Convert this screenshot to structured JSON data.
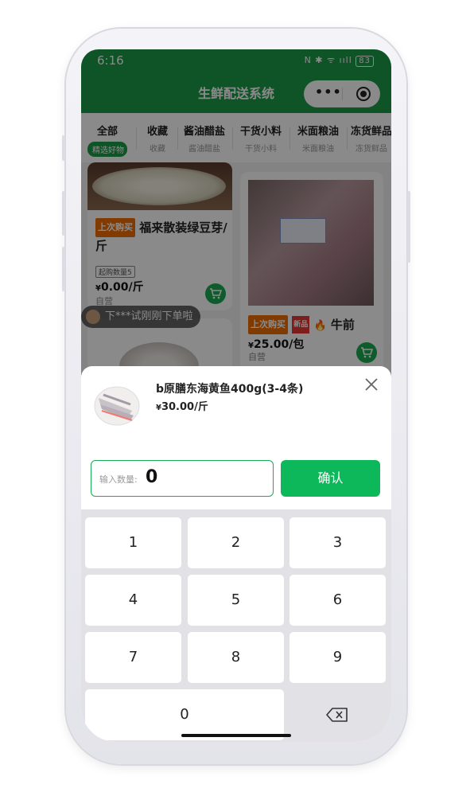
{
  "status_bar": {
    "time": "6:16",
    "icons": "N ✱ ᯤ ııll",
    "battery": "83"
  },
  "header": {
    "title": "生鲜配送系统"
  },
  "categories": [
    {
      "name": "全部",
      "sub": "精选好物"
    },
    {
      "name": "收藏",
      "sub": "收藏"
    },
    {
      "name": "酱油醋盐",
      "sub": "酱油醋盐"
    },
    {
      "name": "干货小料",
      "sub": "干货小料"
    },
    {
      "name": "米面粮油",
      "sub": "米面粮油"
    },
    {
      "name": "冻货鲜品",
      "sub": "冻货鲜品"
    }
  ],
  "toast": {
    "text": "下***试刚刚下单啦"
  },
  "products": [
    {
      "tag": "上次购买",
      "title": "福来散装绿豆芽/斤",
      "min_buy": "起购数量5",
      "price": "0.00",
      "unit": "/斤",
      "currency": "¥",
      "source": "自营"
    },
    {
      "tag": "上次购买",
      "badge": "新品",
      "title": "牛前",
      "price": "25.00",
      "unit": "/包",
      "currency": "¥",
      "source": "自营"
    }
  ],
  "sheet": {
    "product_name": "b原膳东海黄鱼400g(3-4条)",
    "currency": "¥",
    "price": "30.00",
    "unit": "/斤",
    "qty_label": "输入数量:",
    "qty_value": "0",
    "confirm_label": "确认"
  },
  "keypad": {
    "keys": [
      "1",
      "2",
      "3",
      "4",
      "5",
      "6",
      "7",
      "8",
      "9",
      "0"
    ]
  },
  "colors": {
    "brand_green": "#1a9b46",
    "confirm_green": "#0db85b",
    "tag_orange": "#ef6c00"
  }
}
